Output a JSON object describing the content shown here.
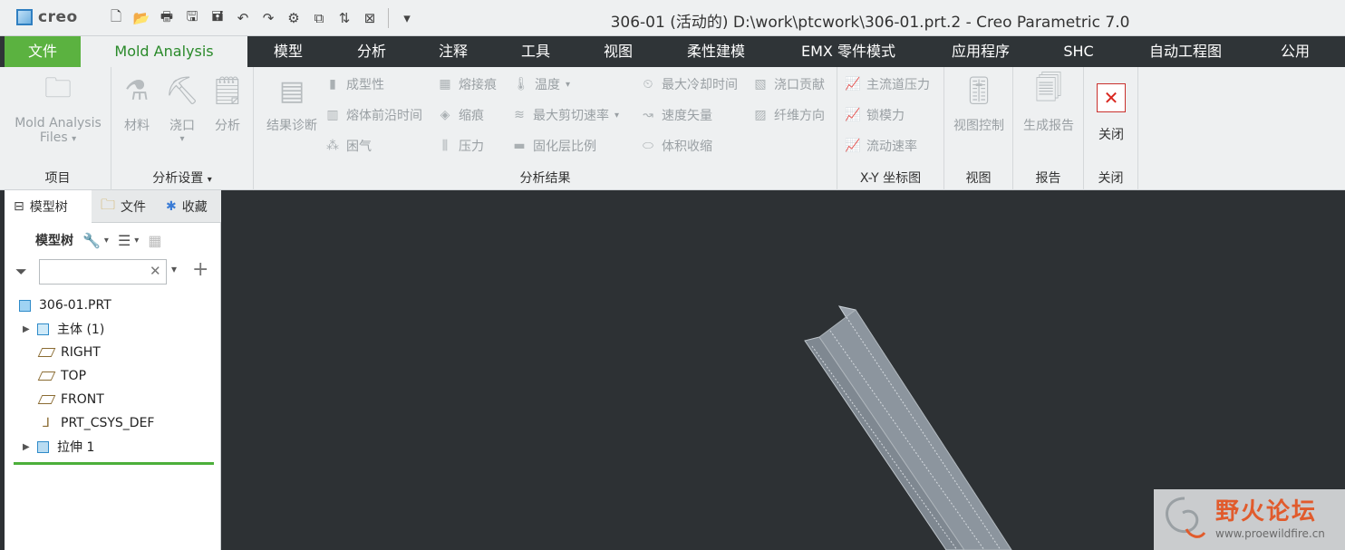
{
  "app": {
    "logo_text": "creo",
    "window_title": "306-01 (活动的) D:\\work\\ptcwork\\306-01.prt.2 - Creo Parametric 7.0"
  },
  "ribbon_tabs": [
    "文件",
    "Mold Analysis",
    "模型",
    "分析",
    "注释",
    "工具",
    "视图",
    "柔性建模",
    "EMX 零件模式",
    "应用程序",
    "SHC",
    "自动工程图",
    "公用"
  ],
  "groups": {
    "project": {
      "label": "项目",
      "files_line1": "Mold Analysis",
      "files_line2": "Files"
    },
    "setup": {
      "label": "分析设置",
      "material": "材料",
      "gate": "浇口",
      "analysis": "分析"
    },
    "results": {
      "label": "分析结果",
      "diagnosis": "结果诊断",
      "col1": [
        "成型性",
        "熔体前沿时间",
        "困气"
      ],
      "col2": [
        "熔接痕",
        "缩痕",
        "压力"
      ],
      "col3": [
        "温度",
        "最大剪切速率",
        "固化层比例"
      ],
      "col4": [
        "最大冷却时间",
        "速度矢量",
        "体积收缩"
      ],
      "col5": [
        "浇口贡献",
        "纤维方向"
      ]
    },
    "xy": {
      "label": "X-Y 坐标图",
      "items": [
        "主流道压力",
        "锁模力",
        "流动速率"
      ]
    },
    "view": {
      "label": "视图",
      "button": "视图控制"
    },
    "report": {
      "label": "报告",
      "button": "生成报告"
    },
    "close": {
      "label": "关闭",
      "button": "关闭"
    }
  },
  "panel": {
    "tabs": [
      "模型树",
      "文件",
      "收藏"
    ],
    "toolbar_label": "模型树",
    "filter_placeholder": "",
    "tree": [
      {
        "label": "306-01.PRT",
        "icon": "part-icon",
        "expandable": false
      },
      {
        "label": "主体 (1)",
        "icon": "body-icon",
        "expandable": true
      },
      {
        "label": "RIGHT",
        "icon": "datum-plane-icon",
        "expandable": false
      },
      {
        "label": "TOP",
        "icon": "datum-plane-icon",
        "expandable": false
      },
      {
        "label": "FRONT",
        "icon": "datum-plane-icon",
        "expandable": false
      },
      {
        "label": "PRT_CSYS_DEF",
        "icon": "csys-icon",
        "expandable": false
      },
      {
        "label": "拉伸 1",
        "icon": "extrude-icon",
        "expandable": true
      }
    ]
  },
  "watermark": {
    "title": "野火论坛",
    "url": "www.proewildfire.cn"
  },
  "colors": {
    "file_tab": "#5bb240",
    "active_tab_text": "#2a8a2a",
    "viewport_bg": "#2d3134",
    "tabbar_bg": "#2f3437"
  }
}
